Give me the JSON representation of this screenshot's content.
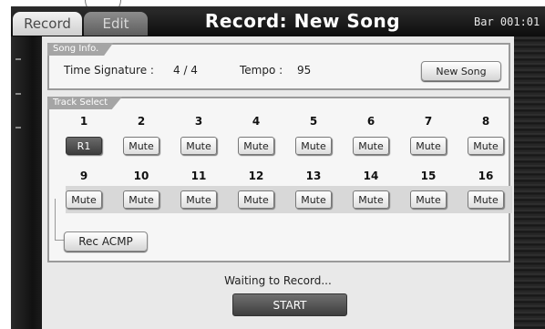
{
  "header": {
    "tabs": [
      {
        "label": "Record",
        "active": true
      },
      {
        "label": "Edit",
        "active": false
      }
    ],
    "title": "Record: New Song",
    "bar_readout": "Bar 001:01"
  },
  "song_info": {
    "group_label": "Song Info.",
    "time_signature_label": "Time Signature :",
    "time_signature_value": "4 / 4",
    "tempo_label": "Tempo :",
    "tempo_value": "95",
    "new_song_button": "New Song"
  },
  "track_select": {
    "group_label": "Track Select",
    "tracks_row1": [
      {
        "number": "1",
        "button": "R1",
        "active": true
      },
      {
        "number": "2",
        "button": "Mute",
        "active": false
      },
      {
        "number": "3",
        "button": "Mute",
        "active": false
      },
      {
        "number": "4",
        "button": "Mute",
        "active": false
      },
      {
        "number": "5",
        "button": "Mute",
        "active": false
      },
      {
        "number": "6",
        "button": "Mute",
        "active": false
      },
      {
        "number": "7",
        "button": "Mute",
        "active": false
      },
      {
        "number": "8",
        "button": "Mute",
        "active": false
      }
    ],
    "tracks_row2": [
      {
        "number": "9",
        "button": "Mute",
        "active": false
      },
      {
        "number": "10",
        "button": "Mute",
        "active": false
      },
      {
        "number": "11",
        "button": "Mute",
        "active": false
      },
      {
        "number": "12",
        "button": "Mute",
        "active": false
      },
      {
        "number": "13",
        "button": "Mute",
        "active": false
      },
      {
        "number": "14",
        "button": "Mute",
        "active": false
      },
      {
        "number": "15",
        "button": "Mute",
        "active": false
      },
      {
        "number": "16",
        "button": "Mute",
        "active": false
      }
    ],
    "rec_acmp_button": "Rec ACMP"
  },
  "status_text": "Waiting to Record...",
  "start_button": "START",
  "colors": {
    "header_bg": "#111111",
    "panel_bg": "#e9e9e9",
    "active_track": "#4a4a4a",
    "group_label_bg": "#a5a5a5"
  }
}
